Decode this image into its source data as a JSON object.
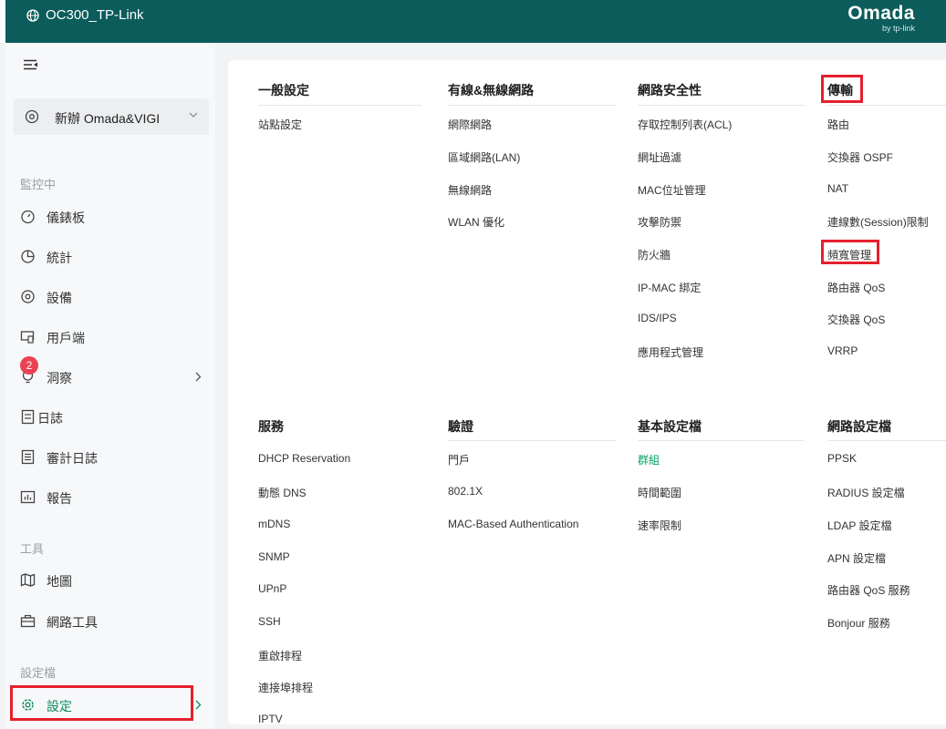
{
  "header": {
    "controller_name": "OC300_TP-Link",
    "logo_brand": "Omada",
    "logo_sub": "by tp-link"
  },
  "sidebar": {
    "site_name": "新辦 Omada&VIGI",
    "sections": {
      "monitor": "監控中",
      "tools": "工具",
      "config": "設定檔"
    },
    "items": {
      "dashboard": "儀錶板",
      "statistics": "統計",
      "devices": "設備",
      "clients": "用戶端",
      "insights": "洞察",
      "logs": "日誌",
      "audit_logs": "審計日誌",
      "reports": "報告",
      "map": "地圖",
      "network_tools": "網路工具",
      "settings": "設定"
    },
    "logs_badge": "2"
  },
  "settings_menu": {
    "general": {
      "title": "一般設定",
      "items": [
        "站點設定"
      ]
    },
    "wired_wireless": {
      "title": "有線&無線網路",
      "items": [
        "網際網路",
        "區域網路(LAN)",
        "無線網路",
        "WLAN 優化"
      ]
    },
    "security": {
      "title": "網路安全性",
      "items": [
        "存取控制列表(ACL)",
        "網址過濾",
        "MAC位址管理",
        "攻擊防禦",
        "防火牆",
        "IP-MAC 綁定",
        "IDS/IPS",
        "應用程式管理"
      ]
    },
    "transmission": {
      "title": "傳輸",
      "items": [
        "路由",
        "交換器 OSPF",
        "NAT",
        "連線數(Session)限制",
        "頻寬管理",
        "路由器 QoS",
        "交換器 QoS",
        "VRRP"
      ]
    },
    "services": {
      "title": "服務",
      "items": [
        "DHCP Reservation",
        "動態 DNS",
        "mDNS",
        "SNMP",
        "UPnP",
        "SSH",
        "重啟排程",
        "連接埠排程",
        "IPTV"
      ]
    },
    "authentication": {
      "title": "驗證",
      "items": [
        "門戶",
        "802.1X",
        "MAC-Based Authentication"
      ]
    },
    "profiles": {
      "title": "基本設定檔",
      "items": [
        "群組",
        "時間範圍",
        "速率限制"
      ]
    },
    "network_profiles": {
      "title": "網路設定檔",
      "items": [
        "PPSK",
        "RADIUS 設定檔",
        "LDAP 設定檔",
        "APN 設定檔",
        "路由器 QoS 服務",
        "Bonjour 服務"
      ]
    }
  },
  "colors": {
    "header_bg": "#0c5c5c",
    "accent_green": "#0aa266",
    "highlight_red": "#e5202e",
    "badge_red": "#e94253"
  }
}
